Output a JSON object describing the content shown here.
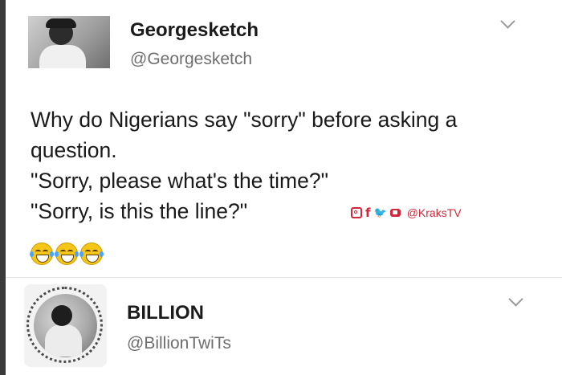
{
  "tweets": [
    {
      "display_name": "Georgesketch",
      "handle": "@Georgesketch",
      "text_lines": [
        "Why do Nigerians say \"sorry\" before asking a",
        "question.",
        "\"Sorry, please what's the time?\"",
        "\"Sorry, is this the line?\""
      ],
      "emojis": [
        "face-with-tears-of-joy",
        "face-with-tears-of-joy",
        "face-with-tears-of-joy"
      ],
      "menu_icon": "chevron-down-icon"
    },
    {
      "display_name": "BILLION",
      "handle": "@BillionTwiTs",
      "menu_icon": "chevron-down-icon"
    }
  ],
  "watermark": {
    "icons": [
      "instagram-icon",
      "facebook-icon",
      "twitter-icon",
      "youtube-icon"
    ],
    "facebook_glyph": "f",
    "twitter_glyph": "🐦",
    "handle": "@KraksTV",
    "color": "#d0283a"
  }
}
